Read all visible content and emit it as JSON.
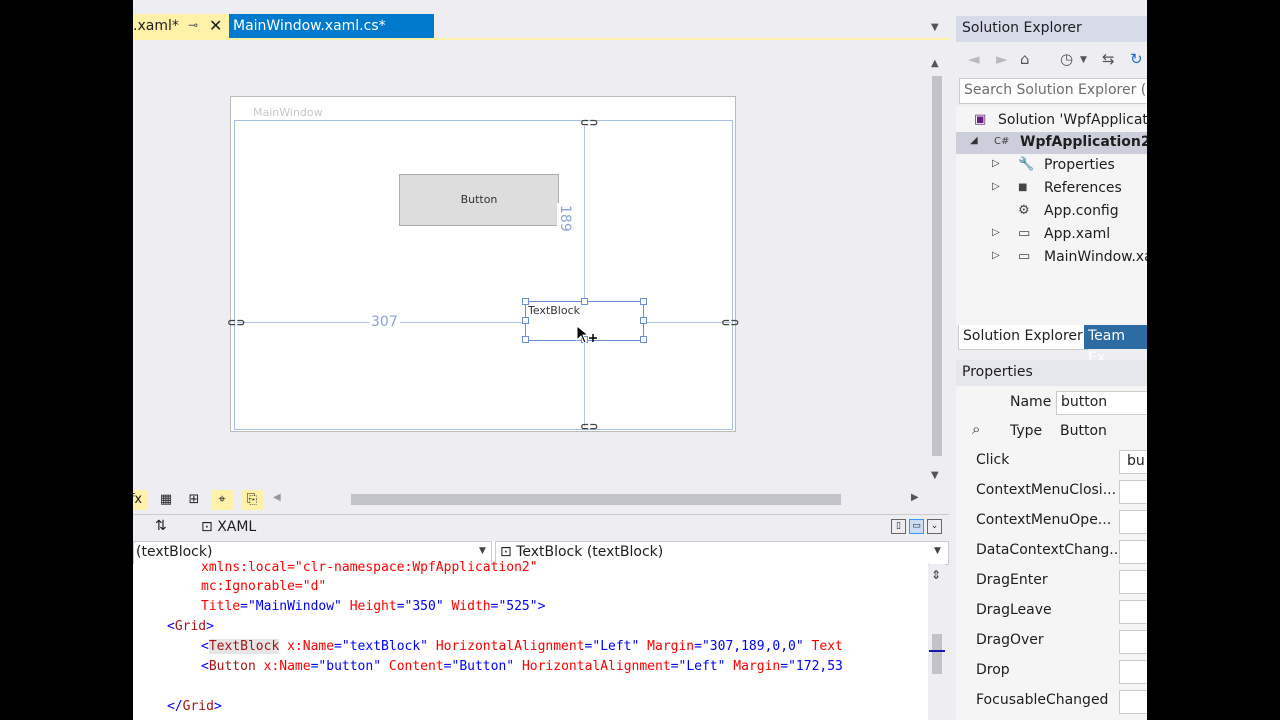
{
  "tabs": {
    "active": {
      "label": ".xaml*",
      "pin": "⊸",
      "close": "✕"
    },
    "inactive": {
      "label": "MainWindow.xaml.cs*"
    },
    "dropdown": "▼"
  },
  "designer": {
    "window_title": "MainWindow",
    "button_content": "Button",
    "textblock_text": "TextBlock",
    "margin_left": "307",
    "margin_top": "189"
  },
  "split": {
    "swap_icon": "⇅",
    "xaml_tab_icon": "⊡",
    "xaml_tab": "XAML"
  },
  "toolbar_icons": [
    "fx",
    "▦",
    "⊞",
    "⌖",
    "⎘"
  ],
  "nav": {
    "left": "(textBlock)",
    "right_icon": "⊡",
    "right": "TextBlock (textBlock)"
  },
  "code": {
    "line0": "xmlns:local=\"clr-namespace:WpfApplication2\"",
    "line1": "mc:Ignorable=\"d\"",
    "line2_title_attr": "Title",
    "line2_title_val": "\"MainWindow\"",
    "line2_height_attr": "Height",
    "line2_height_val": "\"350\"",
    "line2_width_attr": "Width",
    "line2_width_val": "\"525\"",
    "grid_open": "Grid",
    "tb_tag": "TextBlock",
    "tb_name_attr": "x:Name",
    "tb_name_val": "\"textBlock\"",
    "tb_ha_attr": "HorizontalAlignment",
    "tb_ha_val": "\"Left\"",
    "tb_margin_attr": "Margin",
    "tb_margin_val": "\"307,189,0,0\"",
    "tb_more": "Text",
    "btn_tag": "Button",
    "btn_name_attr": "x:Name",
    "btn_name_val": "\"button\"",
    "btn_content_attr": "Content",
    "btn_content_val": "\"Button\"",
    "btn_ha_attr": "HorizontalAlignment",
    "btn_ha_val": "\"Left\"",
    "btn_margin_attr": "Margin",
    "btn_margin_val": "\"172,53",
    "grid_close": "Grid"
  },
  "solution_explorer": {
    "title": "Solution Explorer",
    "search_placeholder": "Search Solution Explorer (Ct",
    "tree": [
      {
        "label": "Solution 'WpfApplicat",
        "icon": "▣"
      },
      {
        "label": "WpfApplication2",
        "icon": "C#",
        "expander": "◢"
      },
      {
        "label": "Properties",
        "icon": "🔧",
        "expander": "▷"
      },
      {
        "label": "References",
        "icon": "■",
        "expander": "▷"
      },
      {
        "label": "App.config",
        "icon": "⚙"
      },
      {
        "label": "App.xaml",
        "icon": "▭",
        "expander": "▷"
      },
      {
        "label": "MainWindow.xa",
        "icon": "▭",
        "expander": "▷"
      }
    ],
    "tab_se": "Solution Explorer",
    "tab_te": "Team Ex"
  },
  "properties": {
    "title": "Properties",
    "name_label": "Name",
    "name_value": "button",
    "type_label": "Type",
    "type_value": "Button",
    "events": [
      {
        "name": "Click",
        "value": "bu"
      },
      {
        "name": "ContextMenuClosi...",
        "value": ""
      },
      {
        "name": "ContextMenuOpe...",
        "value": ""
      },
      {
        "name": "DataContextChang...",
        "value": ""
      },
      {
        "name": "DragEnter",
        "value": ""
      },
      {
        "name": "DragLeave",
        "value": ""
      },
      {
        "name": "DragOver",
        "value": ""
      },
      {
        "name": "Drop",
        "value": ""
      },
      {
        "name": "FocusableChanged",
        "value": ""
      }
    ]
  }
}
